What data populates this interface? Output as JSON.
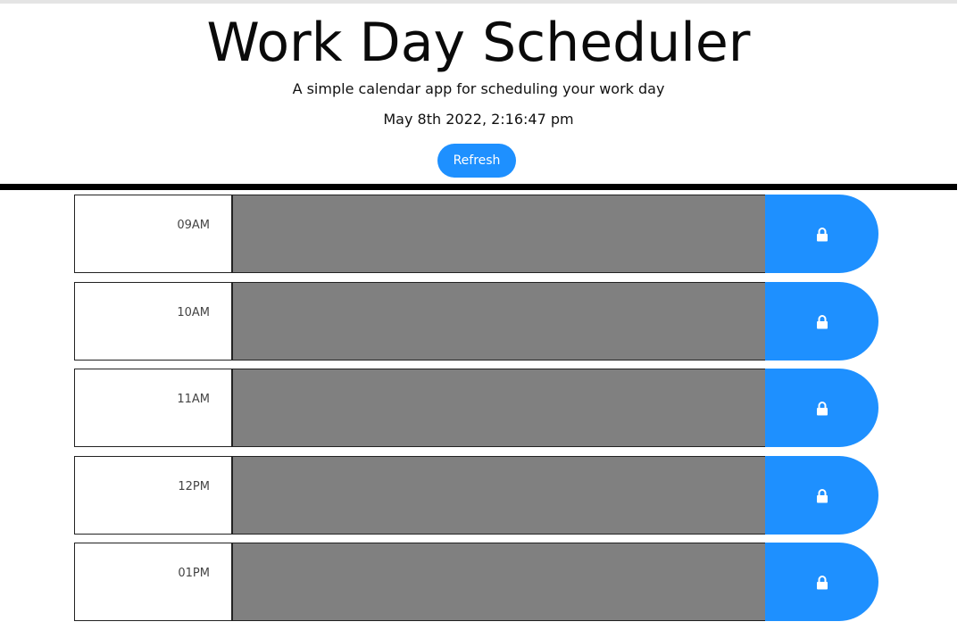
{
  "header": {
    "title": "Work Day Scheduler",
    "subtitle": "A simple calendar app for scheduling your work day",
    "current_datetime": "May 8th 2022, 2:16:47 pm",
    "refresh_label": "Refresh"
  },
  "colors": {
    "accent": "#1e90ff",
    "past_slot": "#808080",
    "divider": "#000000"
  },
  "time_blocks": [
    {
      "hour": "09AM",
      "text": "",
      "save_icon": "lock-icon"
    },
    {
      "hour": "10AM",
      "text": "",
      "save_icon": "lock-icon"
    },
    {
      "hour": "11AM",
      "text": "",
      "save_icon": "lock-icon"
    },
    {
      "hour": "12PM",
      "text": "",
      "save_icon": "lock-icon"
    },
    {
      "hour": "01PM",
      "text": "",
      "save_icon": "lock-icon"
    }
  ]
}
